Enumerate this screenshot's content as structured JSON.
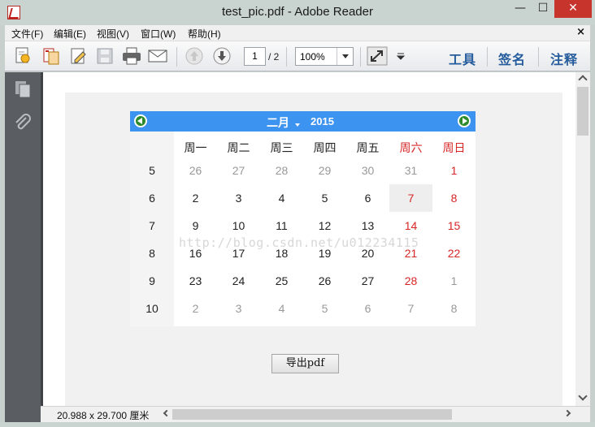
{
  "window": {
    "title": "test_pic.pdf - Adobe Reader"
  },
  "menu": {
    "items": [
      "文件(F)",
      "编辑(E)",
      "视图(V)",
      "窗口(W)",
      "帮助(H)"
    ],
    "close": "×"
  },
  "toolbar": {
    "page_current": "1",
    "page_total": "/ 2",
    "zoom": "100%",
    "links": [
      "工具",
      "签名",
      "注释"
    ]
  },
  "calendar": {
    "month": "二月",
    "year": "2015",
    "weekdays": [
      "周一",
      "周二",
      "周三",
      "周四",
      "周五",
      "周六",
      "周日"
    ],
    "weeks": [
      {
        "num": "5",
        "days": [
          "26",
          "27",
          "28",
          "29",
          "30",
          "31",
          "1"
        ]
      },
      {
        "num": "6",
        "days": [
          "2",
          "3",
          "4",
          "5",
          "6",
          "7",
          "8"
        ]
      },
      {
        "num": "7",
        "days": [
          "9",
          "10",
          "11",
          "12",
          "13",
          "14",
          "15"
        ]
      },
      {
        "num": "8",
        "days": [
          "16",
          "17",
          "18",
          "19",
          "20",
          "21",
          "22"
        ]
      },
      {
        "num": "9",
        "days": [
          "23",
          "24",
          "25",
          "26",
          "27",
          "28",
          "1"
        ]
      },
      {
        "num": "10",
        "days": [
          "2",
          "3",
          "4",
          "5",
          "6",
          "7",
          "8"
        ]
      }
    ]
  },
  "watermark": "http://blog.csdn.net/u012234115",
  "export_button": "导出pdf",
  "status": {
    "size": "20.988 x 29.700",
    "unit": "厘米"
  },
  "colors": {
    "calendar_header": "#3c93f0",
    "weekend": "#d72626",
    "close_button": "#c7342b"
  }
}
